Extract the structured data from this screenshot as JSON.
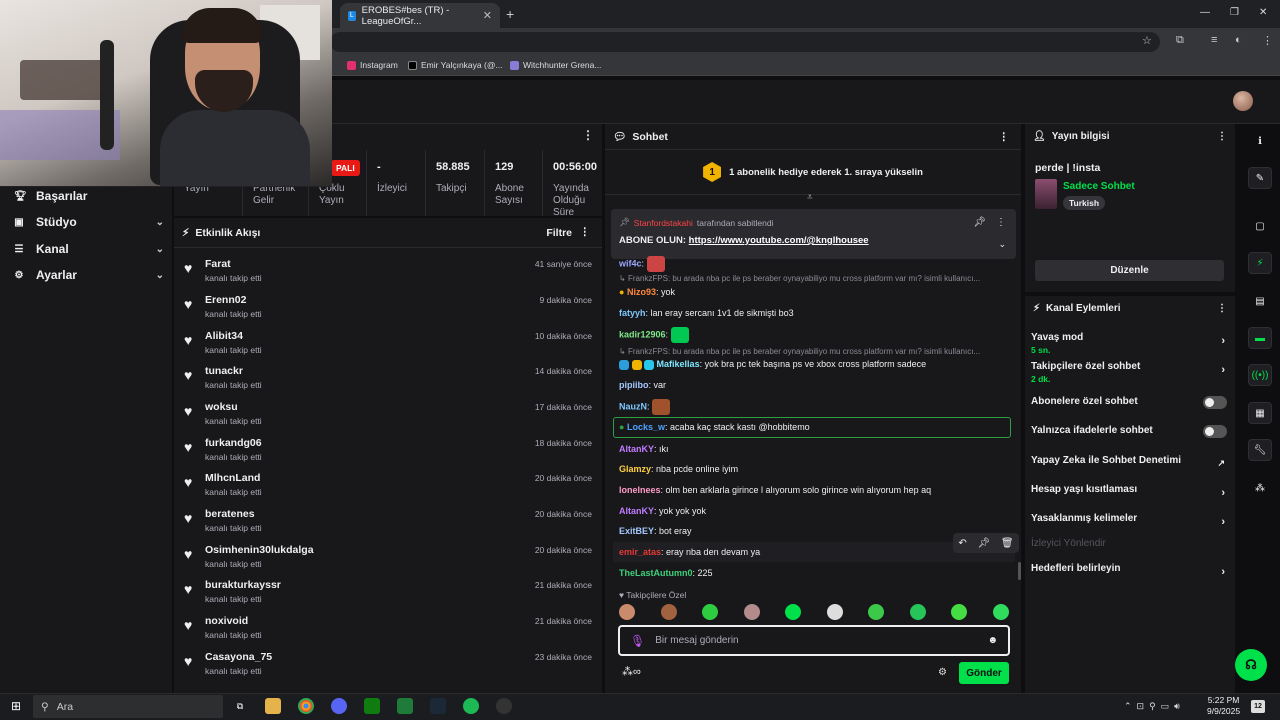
{
  "browser": {
    "tab_title": "EROBES#bes (TR) - LeagueOfGr...",
    "tab_favicon": "L",
    "bookmarks": [
      "Instagram",
      "Emir Yalçınkaya (@...",
      "Witchhunter Grena..."
    ]
  },
  "sidebar": {
    "items": [
      {
        "label": "Başarılar",
        "icon": "trophy-icon"
      },
      {
        "label": "Stüdyo",
        "icon": "video-icon"
      },
      {
        "label": "Kanal",
        "icon": "list-icon"
      },
      {
        "label": "Ayarlar",
        "icon": "gear-icon"
      }
    ]
  },
  "stats": {
    "badge": "PALI",
    "items": [
      {
        "value": "",
        "label": "Yayın"
      },
      {
        "value": "",
        "label": "Partnerlik Gelir"
      },
      {
        "value": "",
        "label": "Çoklu Yayın"
      },
      {
        "value": "-",
        "label": "İzleyici"
      },
      {
        "value": "58.885",
        "label": "Takipçi"
      },
      {
        "value": "129",
        "label": "Abone Sayısı"
      },
      {
        "value": "00:56:00",
        "label": "Yayında Olduğu Süre"
      }
    ]
  },
  "feed": {
    "title": "Etkinlik Akışı",
    "filter": "Filtre",
    "items": [
      {
        "name": "Farat",
        "sub": "kanalı takip etti",
        "time": "41 saniye önce"
      },
      {
        "name": "Erenn02",
        "sub": "kanalı takip etti",
        "time": "9 dakika önce"
      },
      {
        "name": "Alibit34",
        "sub": "kanalı takip etti",
        "time": "10 dakika önce"
      },
      {
        "name": "tunackr",
        "sub": "kanalı takip etti",
        "time": "14 dakika önce"
      },
      {
        "name": "woksu",
        "sub": "kanalı takip etti",
        "time": "17 dakika önce"
      },
      {
        "name": "furkandg06",
        "sub": "kanalı takip etti",
        "time": "18 dakika önce"
      },
      {
        "name": "MlhcnLand",
        "sub": "kanalı takip etti",
        "time": "20 dakika önce"
      },
      {
        "name": "beratenes",
        "sub": "kanalı takip etti",
        "time": "20 dakika önce"
      },
      {
        "name": "Osimhenin30lukdalga",
        "sub": "kanalı takip etti",
        "time": "20 dakika önce"
      },
      {
        "name": "burakturkayssr",
        "sub": "kanalı takip etti",
        "time": "21 dakika önce"
      },
      {
        "name": "noxivoid",
        "sub": "kanalı takip etti",
        "time": "21 dakika önce"
      },
      {
        "name": "Casayona_75",
        "sub": "kanalı takip etti",
        "time": "23 dakika önce"
      }
    ]
  },
  "chat": {
    "title": "Sohbet",
    "hype": "1 abonelik hediye ederek 1. sıraya yükselin",
    "hype_num": "1",
    "pinned": {
      "by_user": "Stanfordstakahi",
      "by_text": "tarafından sabitlendi",
      "msg_label": "ABONE OLUN:",
      "link": "https://www.youtube.com/@knglhousee"
    },
    "messages": [
      {
        "user": "wif4c",
        "color": "#9aa7ff",
        "text": ":",
        "type": "msg"
      },
      {
        "type": "reply",
        "text": "FrankzFPS: bu arada nba pc ile ps beraber oynayabiliyo mu cross platform var mı? isimli kullanıcı..."
      },
      {
        "user": "Nizo93",
        "color": "#ff8a3d",
        "text": ": yok",
        "type": "msg"
      },
      {
        "user": "fatyyh",
        "color": "#7ec8ff",
        "text": ": lan eray sercanı 1v1 de sikmişti bo3",
        "type": "msg"
      },
      {
        "user": "kadir12906",
        "color": "#7ee787",
        "text": ":",
        "type": "msg"
      },
      {
        "type": "reply",
        "text": "FrankzFPS: bu arada nba pc ile ps beraber oynayabiliyo mu cross platform var mı? isimli kullanıcı..."
      },
      {
        "user": "Mafikellas",
        "color": "#7ee7ff",
        "text": ": yok bra pc tek başına ps ve xbox cross platform sadece",
        "type": "msg"
      },
      {
        "user": "pipiibo",
        "color": "#a6c8ff",
        "text": ": var",
        "type": "msg"
      },
      {
        "user": "NauzN",
        "color": "#7ec8ff",
        "text": ":",
        "type": "msg"
      },
      {
        "user": "Locks_w",
        "color": "#4ea1ff",
        "text": ": acaba kaç stack kastı @hobbitemo",
        "type": "msg"
      },
      {
        "user": "AltanKY",
        "color": "#c07cff",
        "text": ": ıkı",
        "type": "msg"
      },
      {
        "user": "Glamzy",
        "color": "#ffd23f",
        "text": ": nba pcde online iyim",
        "type": "msg"
      },
      {
        "user": "lonelnees",
        "color": "#ff9cc8",
        "text": ": olm ben arklarla girince l alıyorum solo girince win alıyorum hep aq",
        "type": "msg"
      },
      {
        "user": "AltanKY",
        "color": "#c07cff",
        "text": ": yok yok yok",
        "type": "msg"
      },
      {
        "user": "ExitBEY",
        "color": "#a6c8ff",
        "text": ": bot eray",
        "type": "msg"
      },
      {
        "user": "emir_atas",
        "color": "#e53935",
        "text": ": eray nba den devam ya",
        "type": "msg"
      },
      {
        "user": "TheLastAutumn0",
        "color": "#3fd07a",
        "text": ": 225",
        "type": "msg"
      }
    ],
    "followers_only": "Takipçilere Özel",
    "input_placeholder": "Bir mesaj gönderin",
    "send": "Gönder"
  },
  "info": {
    "title": "Yayın bilgisi",
    "stream_title": "perde | !insta",
    "category": "Sadece Sohbet",
    "tag": "Turkish",
    "edit": "Düzenle"
  },
  "actions": {
    "title": "Kanal Eylemleri",
    "items": [
      {
        "label": "Yavaş mod",
        "sub": "5 sn.",
        "kind": "chev"
      },
      {
        "label": "Takipçilere özel sohbet",
        "sub": "2 dk.",
        "kind": "chev"
      },
      {
        "label": "Abonelere özel sohbet",
        "sub": "",
        "kind": "toggle"
      },
      {
        "label": "Yalnızca ifadelerle sohbet",
        "sub": "",
        "kind": "toggle"
      },
      {
        "label": "Yapay Zeka ile Sohbet Denetimi",
        "sub": "",
        "kind": "ext"
      },
      {
        "label": "Hesap yaşı kısıtlaması",
        "sub": "",
        "kind": "chev"
      },
      {
        "label": "Yasaklanmış kelimeler",
        "sub": "",
        "kind": "chev"
      },
      {
        "label": "İzleyici Yönlendir",
        "sub": "",
        "kind": "disabled"
      },
      {
        "label": "Hedefleri belirleyin",
        "sub": "",
        "kind": "chev"
      }
    ]
  },
  "taskbar": {
    "search": "Ara",
    "time": "5:22 PM",
    "date": "9/9/2025",
    "notif": "12"
  }
}
